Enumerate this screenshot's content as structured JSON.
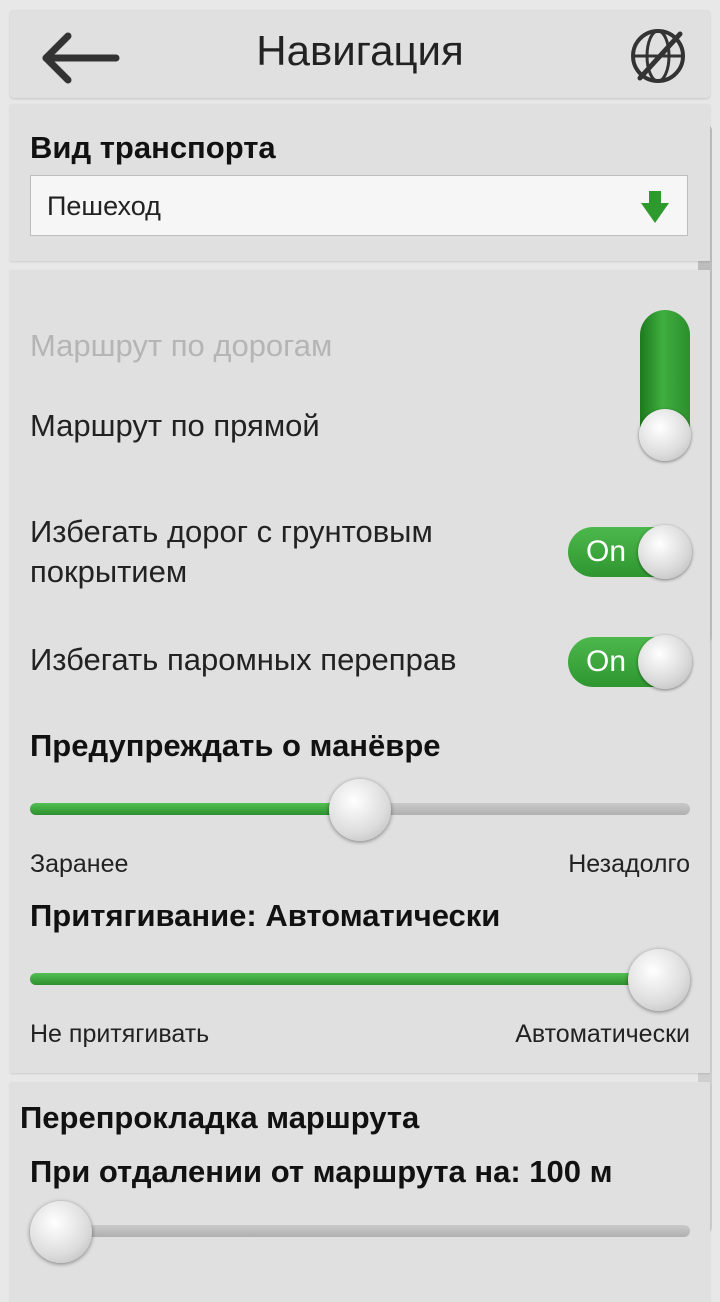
{
  "header": {
    "title": "Навигация",
    "back_icon": "arrow-left-icon",
    "action_icon": "globe-crossed-icon"
  },
  "transport": {
    "section_title": "Вид транспорта",
    "selected": "Пешеход",
    "arrow_icon": "green-down-arrow-icon"
  },
  "routing": {
    "by_roads_label": "Маршрут по дорогам",
    "straight_label": "Маршрут по прямой",
    "avoid_unpaved_label_line1": "Избегать дорог с грунтовым",
    "avoid_unpaved_label_line2": "покрытием",
    "avoid_unpaved_state": "On",
    "avoid_ferries_label": "Избегать паромных переправ",
    "avoid_ferries_state": "On"
  },
  "maneuver": {
    "title": "Предупреждать о манёвре",
    "value_fraction": 0.5,
    "min_label": "Заранее",
    "max_label": "Незадолго"
  },
  "snapping": {
    "title": "Притягивание: Автоматически",
    "value_fraction": 1.0,
    "min_label": "Не притягивать",
    "max_label": "Автоматически"
  },
  "reroute": {
    "section_title": "Перепрокладка маршрута",
    "distance_label": "При отдалении от маршрута на: 100 м",
    "value_fraction": 0.0
  },
  "colors": {
    "accent_green": "#3aa63a",
    "background": "#e0e0e0"
  }
}
